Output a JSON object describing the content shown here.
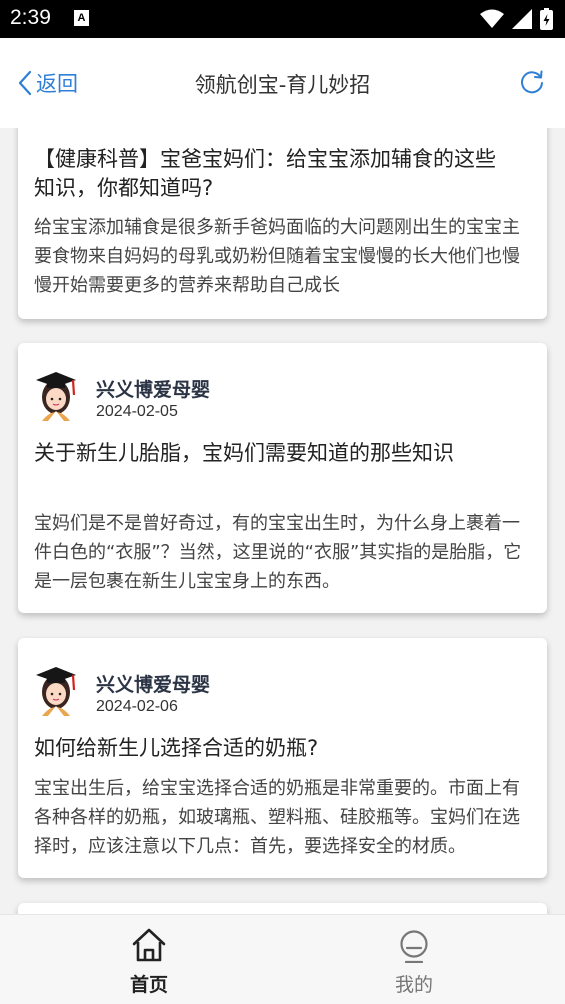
{
  "status_bar": {
    "time": "2:39",
    "notification_glyph": "A"
  },
  "header": {
    "back_label": "返回",
    "title": "领航创宝-育儿妙招"
  },
  "cards": [
    {
      "title": "【健康科普】宝爸宝妈们：给宝宝添加辅食的这些知识，你都知道吗?",
      "body": "给宝宝添加辅食是很多新手爸妈面临的大问题刚出生的宝宝主要食物来自妈妈的母乳或奶粉但随着宝宝慢慢的长大他们也慢慢开始需要更多的营养来帮助自己成长"
    },
    {
      "author": "兴义博爱母婴",
      "date": "2024-02-05",
      "title": "关于新生儿胎脂，宝妈们需要知道的那些知识",
      "body": "宝妈们是不是曾好奇过，有的宝宝出生时，为什么身上裹着一件白色的“衣服”？当然，这里说的“衣服”其实指的是胎脂，它是一层包裹在新生儿宝宝身上的东西。"
    },
    {
      "author": "兴义博爱母婴",
      "date": "2024-02-06",
      "title": "如何给新生儿选择合适的奶瓶?",
      "body": "宝宝出生后，给宝宝选择合适的奶瓶是非常重要的。市面上有各种各样的奶瓶，如玻璃瓶、塑料瓶、硅胶瓶等。宝妈们在选择时，应该注意以下几点：首先，要选择安全的材质。"
    }
  ],
  "tabs": [
    {
      "label": "首页",
      "icon": "home-icon",
      "active": true
    },
    {
      "label": "我的",
      "icon": "profile-icon",
      "active": false
    }
  ],
  "colors": {
    "accent": "#2f7fd6",
    "background": "#f2f2f2"
  }
}
